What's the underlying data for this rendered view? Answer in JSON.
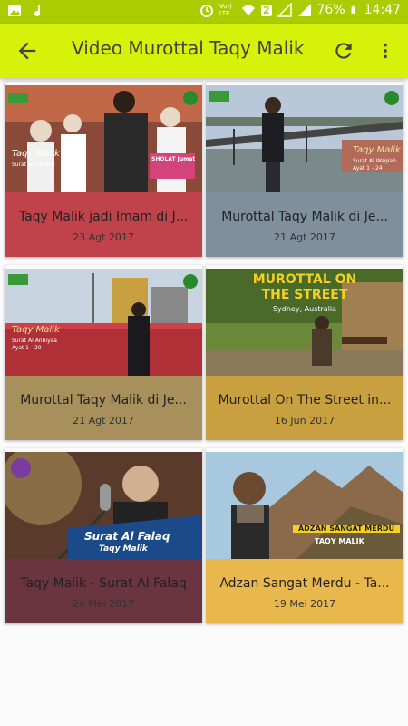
{
  "status_bar": {
    "network_label": "Vo)) LTE",
    "sim_badge": "2",
    "battery": "76%",
    "time": "14:47"
  },
  "app_bar": {
    "title": "Video Murottal Taqy Malik"
  },
  "videos": [
    {
      "title": "Taqy Malik jadi Imam di J...",
      "date": "23 Agt 2017",
      "color": "#c0434c",
      "thumb_text": [
        "Taqy Malik",
        "Surat Al Fatihah",
        "SHOLAT Jumat"
      ]
    },
    {
      "title": "Murottal Taqy Malik di Je...",
      "date": "21 Agt 2017",
      "color": "#7f909c",
      "thumb_text": [
        "Taqy Malik",
        "Surat Al Waqiah",
        "Ayat 1 - 24"
      ]
    },
    {
      "title": "Murottal Taqy Malik di Je...",
      "date": "21 Agt 2017",
      "color": "#a8905c",
      "thumb_text": [
        "Taqy Malik",
        "Surat Al Anbiyaa",
        "Ayat 1 - 20"
      ]
    },
    {
      "title": "Murottal On The Street in...",
      "date": "16 Jun 2017",
      "color": "#c9a040",
      "thumb_text": [
        "MUROTTAL ON",
        "THE STREET",
        "Sydney, Australia"
      ]
    },
    {
      "title": "Taqy Malik - Surat Al Falaq",
      "date": "24 Mei 2017",
      "color": "#6a3540",
      "thumb_text": [
        "Surat Al Falaq",
        "Taqy Malik"
      ]
    },
    {
      "title": "Adzan Sangat Merdu - Ta...",
      "date": "19 Mei 2017",
      "color": "#e8b84c",
      "thumb_text": [
        "ADZAN SANGAT MERDU",
        "TAQY MALIK"
      ]
    }
  ]
}
